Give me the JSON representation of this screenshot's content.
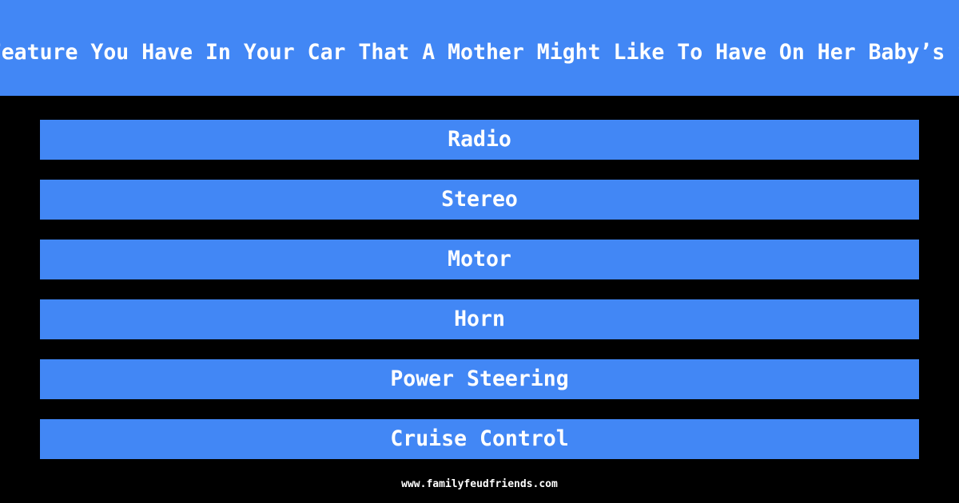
{
  "colors": {
    "accent": "#4287f5",
    "background": "#000000",
    "text": "#ffffff"
  },
  "header": {
    "title": "Name A Feature You Have In Your Car That A Mother Might Like To Have On Her Baby’s Stroller"
  },
  "answers": [
    {
      "label": "Radio"
    },
    {
      "label": "Stereo"
    },
    {
      "label": "Motor"
    },
    {
      "label": "Horn"
    },
    {
      "label": "Power Steering"
    },
    {
      "label": "Cruise Control"
    }
  ],
  "footer": {
    "site": "www.familyfeudfriends.com"
  }
}
